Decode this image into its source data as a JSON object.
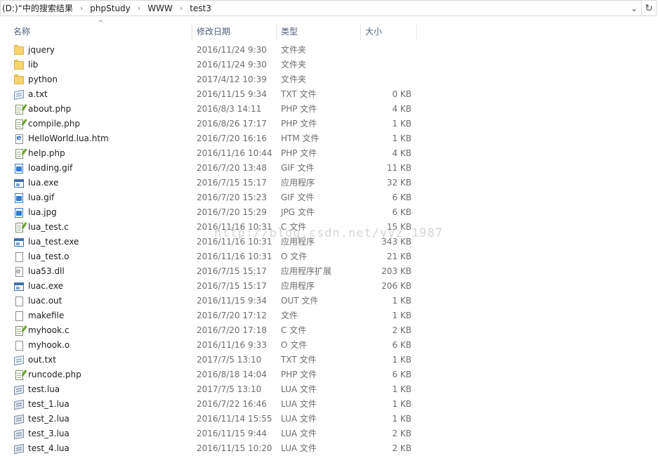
{
  "address_bar": {
    "breadcrumbs": [
      "(D:)“中的搜索结果",
      "phpStudy",
      "WWW",
      "test3"
    ],
    "dropdown_icon": "chevron-down-icon",
    "refresh_icon": "refresh-icon"
  },
  "columns": {
    "name": "名称",
    "date": "修改日期",
    "type": "类型",
    "size": "大小"
  },
  "files": [
    {
      "name": "jquery",
      "date": "2016/11/24 9:30",
      "type": "文件夹",
      "size": "",
      "icon": "folder"
    },
    {
      "name": "lib",
      "date": "2016/11/24 9:30",
      "type": "文件夹",
      "size": "",
      "icon": "folder"
    },
    {
      "name": "python",
      "date": "2017/4/12 10:39",
      "type": "文件夹",
      "size": "",
      "icon": "folder"
    },
    {
      "name": "a.txt",
      "date": "2016/11/15 9:34",
      "type": "TXT 文件",
      "size": "0 KB",
      "icon": "txt"
    },
    {
      "name": "about.php",
      "date": "2016/8/3 14:11",
      "type": "PHP 文件",
      "size": "4 KB",
      "icon": "edit"
    },
    {
      "name": "compile.php",
      "date": "2016/8/26 17:17",
      "type": "PHP 文件",
      "size": "1 KB",
      "icon": "edit"
    },
    {
      "name": "HelloWorld.lua.htm",
      "date": "2016/7/20 16:16",
      "type": "HTM 文件",
      "size": "1 KB",
      "icon": "htm"
    },
    {
      "name": "help.php",
      "date": "2016/11/16 10:44",
      "type": "PHP 文件",
      "size": "4 KB",
      "icon": "edit"
    },
    {
      "name": "loading.gif",
      "date": "2016/7/20 13:48",
      "type": "GIF 文件",
      "size": "11 KB",
      "icon": "img"
    },
    {
      "name": "lua.exe",
      "date": "2016/7/15 15:17",
      "type": "应用程序",
      "size": "32 KB",
      "icon": "exe"
    },
    {
      "name": "lua.gif",
      "date": "2016/7/20 15:23",
      "type": "GIF 文件",
      "size": "6 KB",
      "icon": "img"
    },
    {
      "name": "lua.jpg",
      "date": "2016/7/20 15:29",
      "type": "JPG 文件",
      "size": "6 KB",
      "icon": "img"
    },
    {
      "name": "lua_test.c",
      "date": "2016/11/16 10:31",
      "type": "C 文件",
      "size": "15 KB",
      "icon": "edit"
    },
    {
      "name": "lua_test.exe",
      "date": "2016/11/16 10:31",
      "type": "应用程序",
      "size": "343 KB",
      "icon": "exe"
    },
    {
      "name": "lua_test.o",
      "date": "2016/11/16 10:31",
      "type": "O 文件",
      "size": "21 KB",
      "icon": "doc"
    },
    {
      "name": "lua53.dll",
      "date": "2016/7/15 15:17",
      "type": "应用程序扩展",
      "size": "203 KB",
      "icon": "dll"
    },
    {
      "name": "luac.exe",
      "date": "2016/7/15 15:17",
      "type": "应用程序",
      "size": "206 KB",
      "icon": "exe"
    },
    {
      "name": "luac.out",
      "date": "2016/11/15 9:34",
      "type": "OUT 文件",
      "size": "1 KB",
      "icon": "doc"
    },
    {
      "name": "makefile",
      "date": "2016/7/20 17:12",
      "type": "文件",
      "size": "1 KB",
      "icon": "doc"
    },
    {
      "name": "myhook.c",
      "date": "2016/7/20 17:18",
      "type": "C 文件",
      "size": "2 KB",
      "icon": "edit"
    },
    {
      "name": "myhook.o",
      "date": "2016/11/16 9:33",
      "type": "O 文件",
      "size": "6 KB",
      "icon": "doc"
    },
    {
      "name": "out.txt",
      "date": "2017/7/5 13:10",
      "type": "TXT 文件",
      "size": "1 KB",
      "icon": "txt"
    },
    {
      "name": "runcode.php",
      "date": "2016/8/18 14:04",
      "type": "PHP 文件",
      "size": "6 KB",
      "icon": "edit"
    },
    {
      "name": "test.lua",
      "date": "2017/7/5 13:10",
      "type": "LUA 文件",
      "size": "1 KB",
      "icon": "lua"
    },
    {
      "name": "test_1.lua",
      "date": "2016/7/22 16:46",
      "type": "LUA 文件",
      "size": "1 KB",
      "icon": "lua"
    },
    {
      "name": "test_2.lua",
      "date": "2016/11/14 15:55",
      "type": "LUA 文件",
      "size": "1 KB",
      "icon": "lua"
    },
    {
      "name": "test_3.lua",
      "date": "2016/11/15 9:44",
      "type": "LUA 文件",
      "size": "2 KB",
      "icon": "lua"
    },
    {
      "name": "test_4.lua",
      "date": "2016/11/15 10:20",
      "type": "LUA 文件",
      "size": "2 KB",
      "icon": "lua"
    }
  ],
  "watermark": "http://blog.csdn.net/yyz_1987"
}
